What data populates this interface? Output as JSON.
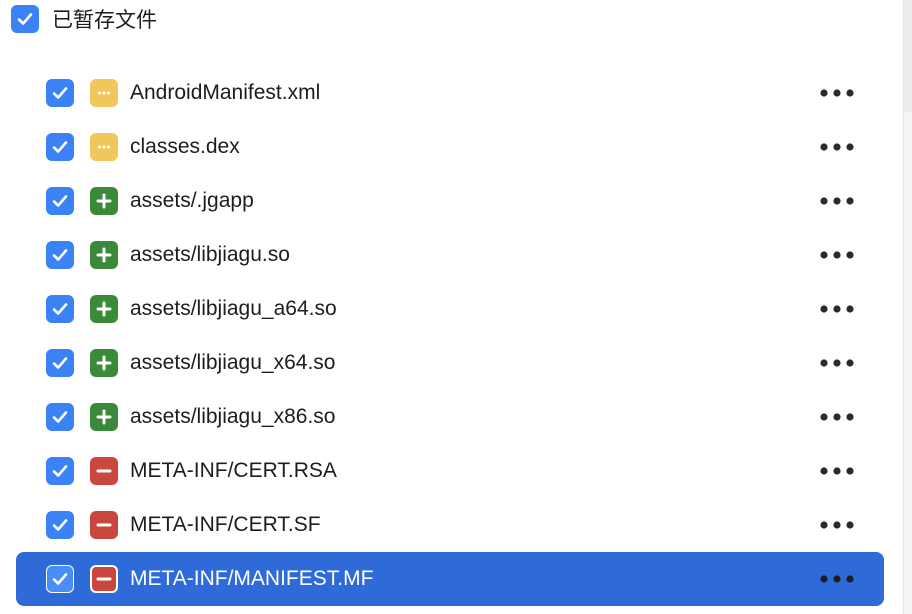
{
  "header": {
    "label": "已暂存文件",
    "checked": true
  },
  "files": [
    {
      "name": "AndroidManifest.xml",
      "status": "modified",
      "checked": true,
      "selected": false
    },
    {
      "name": "classes.dex",
      "status": "modified",
      "checked": true,
      "selected": false
    },
    {
      "name": "assets/.jgapp",
      "status": "added",
      "checked": true,
      "selected": false
    },
    {
      "name": "assets/libjiagu.so",
      "status": "added",
      "checked": true,
      "selected": false
    },
    {
      "name": "assets/libjiagu_a64.so",
      "status": "added",
      "checked": true,
      "selected": false
    },
    {
      "name": "assets/libjiagu_x64.so",
      "status": "added",
      "checked": true,
      "selected": false
    },
    {
      "name": "assets/libjiagu_x86.so",
      "status": "added",
      "checked": true,
      "selected": false
    },
    {
      "name": "META-INF/CERT.RSA",
      "status": "deleted",
      "checked": true,
      "selected": false
    },
    {
      "name": "META-INF/CERT.SF",
      "status": "deleted",
      "checked": true,
      "selected": false
    },
    {
      "name": "META-INF/MANIFEST.MF",
      "status": "deleted",
      "checked": true,
      "selected": true
    }
  ],
  "colors": {
    "checkbox": "#3b82f6",
    "modified": "#f1c75b",
    "added": "#3a8a3a",
    "deleted": "#c9473f",
    "selection": "#2f6ad9"
  }
}
